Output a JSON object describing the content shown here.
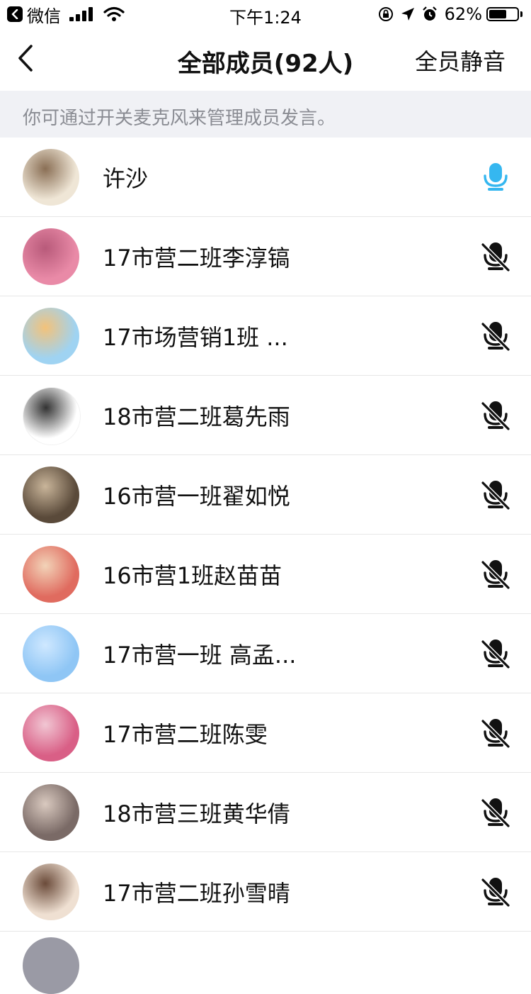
{
  "status_bar": {
    "back_app": "微信",
    "time": "下午1:24",
    "battery": "62%",
    "battery_level": 0.62
  },
  "nav": {
    "title": "全部成员(92人)",
    "action": "全员静音"
  },
  "hint": "你可通过开关麦克风来管理成员发言。",
  "colors": {
    "mic_on": "#35b7f0",
    "mic_off": "#111111",
    "hint_bg": "#f0f1f5"
  },
  "members": [
    {
      "name": "许沙",
      "mic": "on",
      "avatar": [
        "#efe6d6",
        "#8a6f55"
      ]
    },
    {
      "name": "17市营二班李淳镐",
      "mic": "off",
      "avatar": [
        "#e98aa7",
        "#b85a7a"
      ]
    },
    {
      "name": "17市场营销1班  ...",
      "mic": "off",
      "avatar": [
        "#9fd3f2",
        "#f3c27a"
      ]
    },
    {
      "name": "18市营二班葛先雨",
      "mic": "off",
      "avatar": [
        "#ffffff",
        "#333333"
      ]
    },
    {
      "name": "16市营一班翟如悦",
      "mic": "off",
      "avatar": [
        "#5a4a3a",
        "#c9b59a"
      ]
    },
    {
      "name": "16市营1班赵苗苗",
      "mic": "off",
      "avatar": [
        "#e06b5f",
        "#f2d3b8"
      ]
    },
    {
      "name": "17市营一班 高孟...",
      "mic": "off",
      "avatar": [
        "#8fc6f5",
        "#cfe8ff"
      ]
    },
    {
      "name": "17市营二班陈雯",
      "mic": "off",
      "avatar": [
        "#d95f86",
        "#f1c6d3"
      ]
    },
    {
      "name": "18市营三班黄华倩",
      "mic": "off",
      "avatar": [
        "#7a6a66",
        "#d9c9bf"
      ]
    },
    {
      "name": "17市营二班孙雪晴",
      "mic": "off",
      "avatar": [
        "#efe0d2",
        "#6b4b3a"
      ]
    }
  ]
}
